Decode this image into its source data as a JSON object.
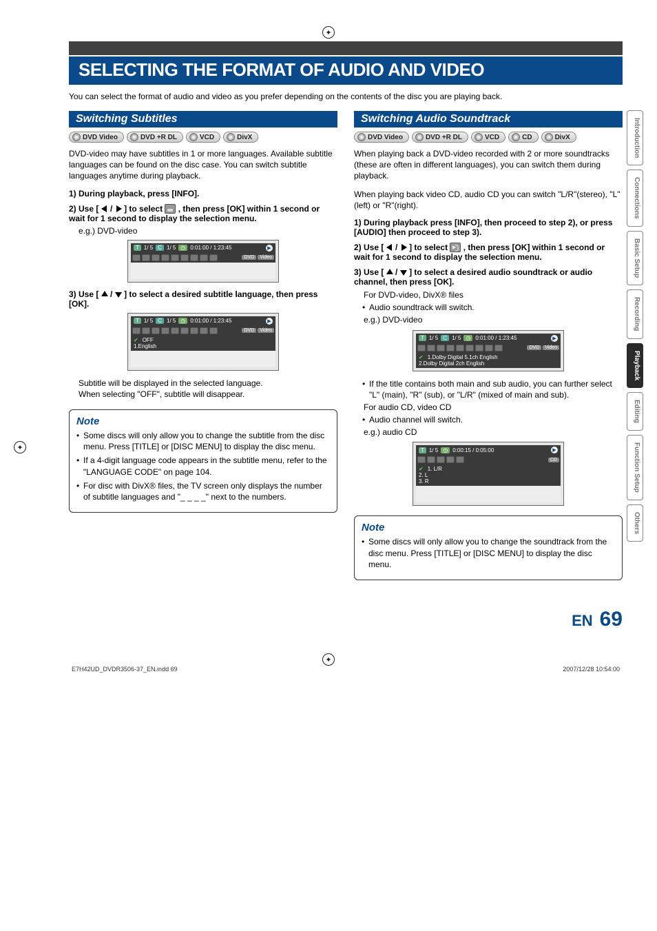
{
  "title": "SELECTING THE FORMAT OF AUDIO AND VIDEO",
  "intro": "You can select the format of audio and video as you prefer depending on the contents of the disc you are playing back.",
  "left": {
    "heading": "Switching Subtitles",
    "badges": [
      "DVD Video",
      "DVD +R DL",
      "VCD",
      "DivX"
    ],
    "para1": "DVD-video may have subtitles in 1 or more languages. Available subtitle languages can be found on the disc case. You can switch subtitle languages anytime during playback.",
    "step1": "1) During playback, press [INFO].",
    "step2_pre": "2) Use [",
    "step2_mid": "] to select ",
    "step2_post": " , then press [OK] within 1 second or wait for 1 second to display the selection menu.",
    "eg1": "e.g.) DVD-video",
    "osd1": {
      "tc": "1/  5",
      "cc": "1/  5",
      "time": "0:01:00 / 1:23:45",
      "disc": "DVD",
      "mode": "Video"
    },
    "step3_pre": "3) Use [",
    "step3_post": "] to select a desired subtitle language, then press [OK].",
    "osd2": {
      "tc": "1/  5",
      "cc": "1/  5",
      "time": "0:01:00 / 1:23:45",
      "disc": "DVD",
      "mode": "Video",
      "opts": [
        "OFF",
        "1.English"
      ]
    },
    "after2a": "Subtitle will be displayed in the selected language.",
    "after2b": "When selecting \"OFF\", subtitle will disappear.",
    "note": {
      "title": "Note",
      "items": [
        "Some discs will only allow you to change the subtitle from the disc menu. Press [TITLE] or [DISC MENU] to display the disc menu.",
        "If a 4-digit language code appears in the subtitle menu, refer to the \"LANGUAGE CODE\" on page 104.",
        "For disc with DivX® files, the TV screen only displays the number of subtitle languages and \"_ _ _ _\" next to the numbers."
      ]
    }
  },
  "right": {
    "heading": "Switching Audio Soundtrack",
    "badges": [
      "DVD Video",
      "DVD +R DL",
      "VCD",
      "CD",
      "DivX"
    ],
    "para1": "When playing back a DVD-video recorded with 2 or more soundtracks (these are often in different languages), you can switch them during playback.",
    "para2": "When playing back video CD, audio CD you can switch \"L/R\"(stereo), \"L\"(left) or \"R\"(right).",
    "step1": "1) During playback press [INFO], then proceed to step 2), or press [AUDIO] then proceed to step 3).",
    "step2_pre": "2) Use [",
    "step2_mid": "] to select ",
    "step2_post": " , then press [OK] within 1 second or wait for 1 second to display the selection menu.",
    "step3_pre": "3) Use [",
    "step3_post": "] to select a desired audio soundtrack or audio channel, then press [OK].",
    "for_dvd": "For DVD-video, DivX® files",
    "bul1": "Audio soundtrack will switch.",
    "eg1": "e.g.) DVD-video",
    "osd1": {
      "tc": "1/  5",
      "cc": "1/  5",
      "time": "0:01:00 / 1:23:45",
      "disc": "DVD",
      "mode": "Video",
      "opts": [
        "1.Dolby Digital   5.1ch English",
        "2.Dolby Digital     2ch English"
      ]
    },
    "bul2": "If the title contains both main and sub audio, you can further select \"L\" (main), \"R\" (sub), or \"L/R\" (mixed of main and sub).",
    "for_cd": "For audio CD, video CD",
    "bul3": "Audio channel will switch.",
    "eg2": "e.g.) audio CD",
    "osd2": {
      "tc": "1/  5",
      "time": "0:00:15 / 0:05:00",
      "disc": "CD",
      "opts": [
        "1. L/R",
        "2. L",
        "3. R"
      ]
    },
    "note": {
      "title": "Note",
      "items": [
        "Some discs will only allow you to change the soundtrack from the disc menu. Press [TITLE] or [DISC MENU] to display the disc menu."
      ]
    }
  },
  "tabs": [
    "Introduction",
    "Connections",
    "Basic Setup",
    "Recording",
    "Playback",
    "Editing",
    "Function Setup",
    "Others"
  ],
  "active_tab": 4,
  "footer": {
    "lang": "EN",
    "page": "69"
  },
  "meta": {
    "left": "E7H42UD_DVDR3506-37_EN.indd   69",
    "right": "2007/12/28   10:54:00"
  }
}
